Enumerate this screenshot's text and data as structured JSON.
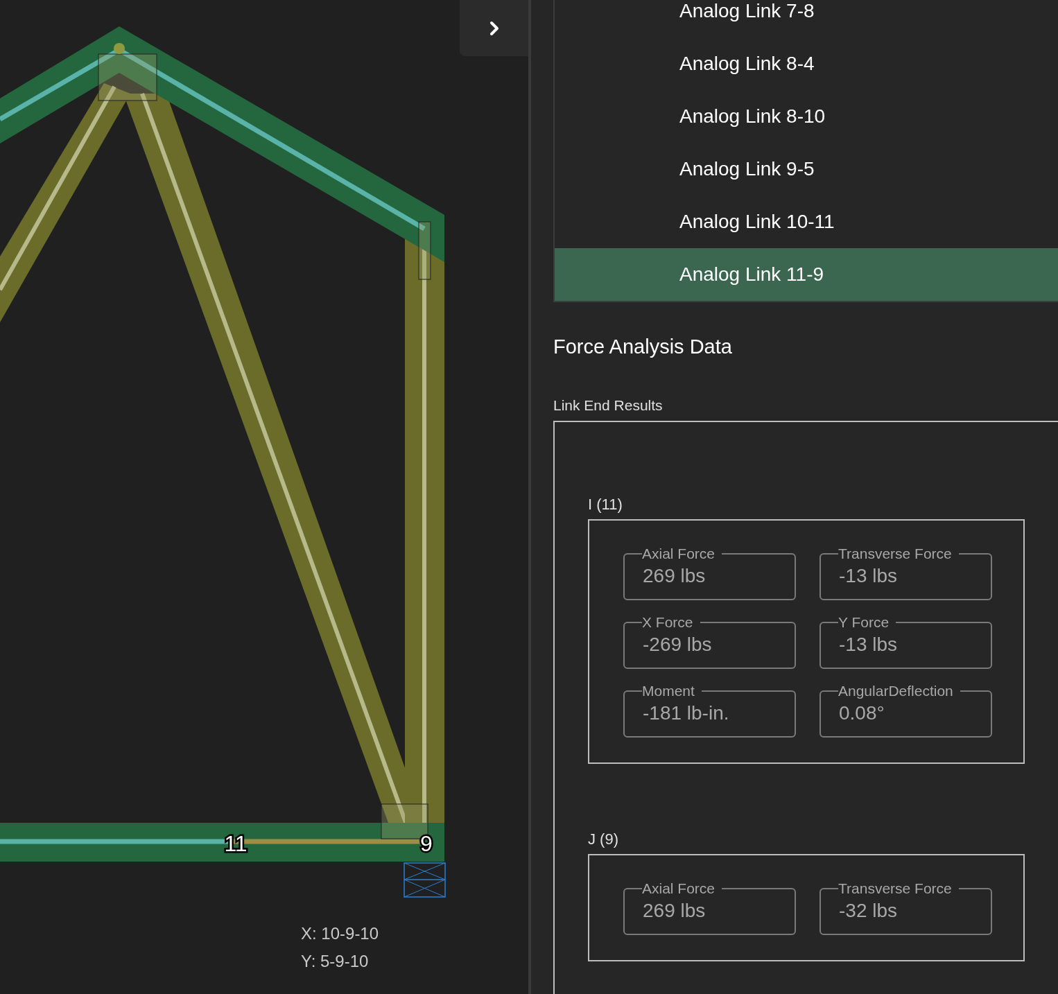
{
  "canvas": {
    "node_labels": [
      {
        "text": "11"
      },
      {
        "text": "9"
      }
    ],
    "coordinates": {
      "x": "X: 10-9-10",
      "y": "Y: 5-9-10"
    }
  },
  "link_list": [
    {
      "label": "Analog Link 7-8",
      "selected": false
    },
    {
      "label": "Analog Link 8-4",
      "selected": false
    },
    {
      "label": "Analog Link 8-10",
      "selected": false
    },
    {
      "label": "Analog Link 9-5",
      "selected": false
    },
    {
      "label": "Analog Link 10-11",
      "selected": false
    },
    {
      "label": "Analog Link 11-9",
      "selected": true
    }
  ],
  "force_analysis": {
    "title": "Force Analysis Data",
    "section": "Link End Results",
    "ends": [
      {
        "label": "I (11)",
        "fields": [
          {
            "label": "Axial Force",
            "value": "269 lbs"
          },
          {
            "label": "Transverse Force",
            "value": "-13 lbs"
          },
          {
            "label": "X Force",
            "value": "-269 lbs"
          },
          {
            "label": "Y Force",
            "value": "-13 lbs"
          },
          {
            "label": "Moment",
            "value": "-181 lb-in."
          },
          {
            "label": "AngularDeflection",
            "value": "0.08°"
          }
        ]
      },
      {
        "label": "J (9)",
        "fields": [
          {
            "label": "Axial Force",
            "value": "269 lbs"
          },
          {
            "label": "Transverse Force",
            "value": "-32 lbs"
          }
        ]
      }
    ]
  }
}
